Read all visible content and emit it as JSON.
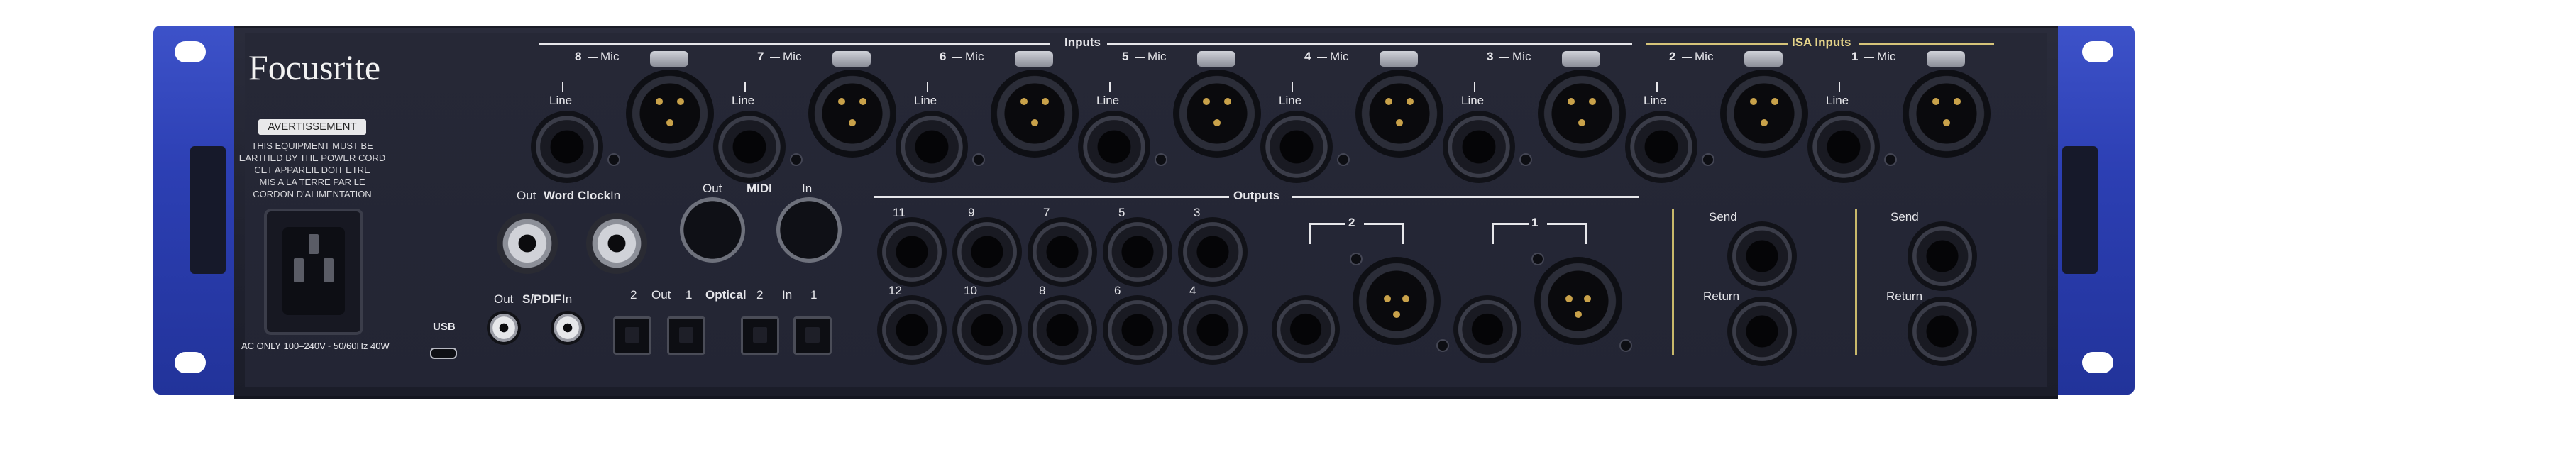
{
  "brand": "Focusrite",
  "warning": {
    "badge": "AVERTISSEMENT",
    "line1": "THIS EQUIPMENT MUST BE",
    "line2": "EARTHED BY THE POWER CORD",
    "line3": "CET APPAREIL DOIT ETRE",
    "line4": "MIS A LA TERRE PAR LE",
    "line5": "CORDON D'ALIMENTATION"
  },
  "power_rating": "AC ONLY 100–240V~ 50/60Hz 40W",
  "usb_label": "USB",
  "inputs_header": "Inputs",
  "isa_header": "ISA Inputs",
  "mic_label": "Mic",
  "line_label": "Line",
  "input_channels": [
    "8",
    "7",
    "6",
    "5",
    "4",
    "3",
    "2",
    "1"
  ],
  "word_clock": {
    "out": "Out",
    "title": "Word Clock",
    "in": "In"
  },
  "midi": {
    "out": "Out",
    "title": "MIDI",
    "in": "In"
  },
  "spdif": {
    "out": "Out",
    "title": "S/PDIF",
    "in": "In"
  },
  "optical": {
    "n2a": "2",
    "out": "Out",
    "n1a": "1",
    "title": "Optical",
    "n2b": "2",
    "in": "In",
    "n1b": "1"
  },
  "outputs_header": "Outputs",
  "output_top": [
    "11",
    "9",
    "7",
    "5",
    "3"
  ],
  "output_bottom": [
    "12",
    "10",
    "8",
    "6",
    "4"
  ],
  "main_outputs": [
    "2",
    "1"
  ],
  "insert_send": "Send",
  "insert_return": "Return",
  "colors": {
    "ear": "#2c3fb3",
    "chassis": "#232534",
    "isa_accent": "#d6c47a"
  }
}
